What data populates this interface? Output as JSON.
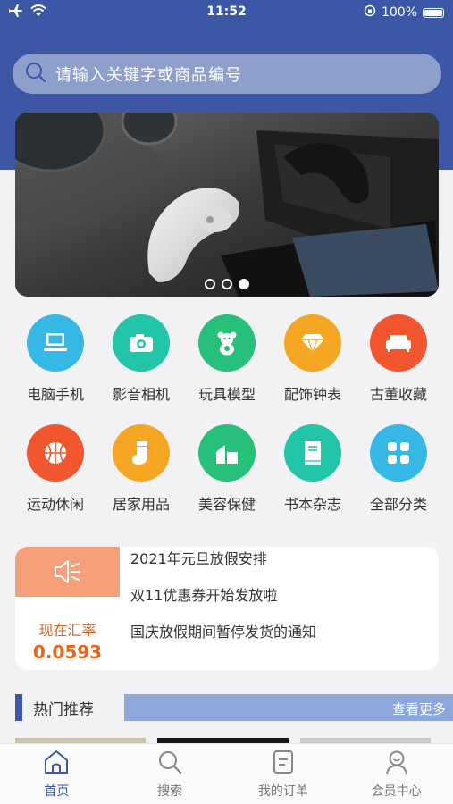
{
  "status_bar": {
    "time": "11:52",
    "battery": "100%"
  },
  "search": {
    "placeholder": "请输入关键字或商品编号"
  },
  "banner": {
    "dots": 3,
    "active_dot": 2
  },
  "categories": [
    {
      "label": "电脑手机",
      "color": "#35b8e6",
      "icon": "laptop-icon"
    },
    {
      "label": "影音相机",
      "color": "#22c5a8",
      "icon": "camera-icon"
    },
    {
      "label": "玩具模型",
      "color": "#27c07a",
      "icon": "bear-toy-icon"
    },
    {
      "label": "配饰钟表",
      "color": "#f5a623",
      "icon": "diamond-icon"
    },
    {
      "label": "古董收藏",
      "color": "#f2562f",
      "icon": "sofa-icon"
    },
    {
      "label": "运动休闲",
      "color": "#f2562f",
      "icon": "basketball-icon"
    },
    {
      "label": "居家用品",
      "color": "#f5a623",
      "icon": "sock-icon"
    },
    {
      "label": "美容保健",
      "color": "#27c07a",
      "icon": "health-icon"
    },
    {
      "label": "书本杂志",
      "color": "#22c5a8",
      "icon": "book-icon"
    },
    {
      "label": "全部分类",
      "color": "#35b8e6",
      "icon": "grid-icon"
    }
  ],
  "notice": {
    "rate_label": "现在汇率",
    "rate_value": "0.0593",
    "items": [
      "2021年元旦放假安排",
      "双11优惠券开始发放啦",
      "国庆放假期间暂停发货的通知"
    ]
  },
  "hot": {
    "title": "热门推荐",
    "more": "查看更多"
  },
  "tabs": [
    {
      "label": "首页",
      "icon": "home-icon",
      "active": true
    },
    {
      "label": "搜索",
      "icon": "search-icon",
      "active": false
    },
    {
      "label": "我的订单",
      "icon": "order-icon",
      "active": false
    },
    {
      "label": "会员中心",
      "icon": "user-icon",
      "active": false
    }
  ],
  "colors": {
    "brand": "#3b57a5",
    "search_bg": "#8f9fcc",
    "more_bg": "#8ea7da",
    "rate": "#e8651a",
    "speaker_bg": "#f5a07a"
  }
}
